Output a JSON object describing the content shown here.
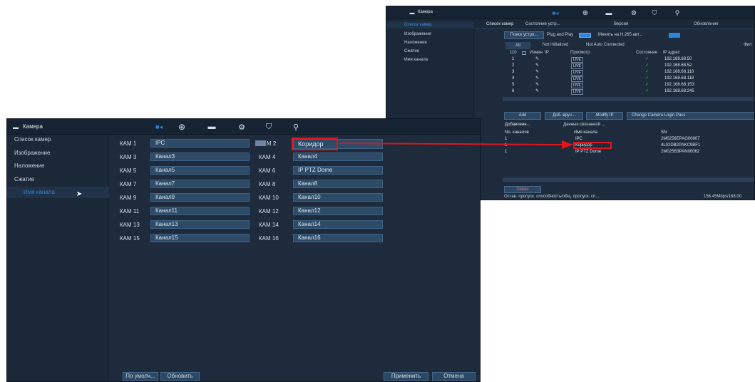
{
  "left": {
    "menu_title": "Камера",
    "sidebar": [
      "Список камер",
      "Изображение",
      "Наложение",
      "Сжатие",
      "Имя канала"
    ],
    "channels": [
      {
        "kam": "КАМ 1",
        "name": "IPC"
      },
      {
        "kam": "M 2",
        "name": "Коридор"
      },
      {
        "kam": "КАМ 3",
        "name": "Канал3"
      },
      {
        "kam": "КАМ 4",
        "name": "Канал4"
      },
      {
        "kam": "КАМ 5",
        "name": "Канал5"
      },
      {
        "kam": "КАМ 6",
        "name": "IP PTZ Dome"
      },
      {
        "kam": "КАМ 7",
        "name": "Канал7"
      },
      {
        "kam": "КАМ 8",
        "name": "Канал8"
      },
      {
        "kam": "КАМ 9",
        "name": "Канал9"
      },
      {
        "kam": "КАМ 10",
        "name": "Канал10"
      },
      {
        "kam": "КАМ 11",
        "name": "Канал11"
      },
      {
        "kam": "КАМ 12",
        "name": "Канал12"
      },
      {
        "kam": "КАМ 13",
        "name": "Канал13"
      },
      {
        "kam": "КАМ 14",
        "name": "Канал14"
      },
      {
        "kam": "КАМ 15",
        "name": "Канал15"
      },
      {
        "kam": "КАМ 16",
        "name": "Канал16"
      }
    ],
    "btn_default": "По умолч...",
    "btn_refresh": "Обновить",
    "btn_apply": "Применить",
    "btn_cancel": "Отмена"
  },
  "right": {
    "menu_title": "Камера",
    "sidebar": [
      "Список камер",
      "Изображение",
      "Наложение",
      "Сжатие",
      "Имя канала"
    ],
    "tabs": [
      "Список камер",
      "Состояние устр...",
      "Версия",
      "Обновление"
    ],
    "btn_search": "Поиск устро...",
    "plug_and_play": "Plug and Play",
    "h265": "Менять на H.265 авт...",
    "filters": [
      "All",
      "Not Initialized",
      "Not Auto Connected",
      "Фил"
    ],
    "cols": [
      "110",
      "Измен. IP",
      "Просмотр",
      "Состояние",
      "IP адрес"
    ],
    "rows": [
      {
        "n": "1",
        "ip": "192.168.68.50"
      },
      {
        "n": "2",
        "ip": "192.168.68.52"
      },
      {
        "n": "3",
        "ip": "192.168.68.110"
      },
      {
        "n": "4",
        "ip": "192.168.68.118"
      },
      {
        "n": "5",
        "ip": "192.168.68.153"
      },
      {
        "n": "6",
        "ip": "192.168.68.245"
      }
    ],
    "live": "LIVE",
    "btns": [
      "Add",
      "Доб. вруч...",
      "Modify IP",
      "Change Camera Login Pass"
    ],
    "added_tabs": [
      "Добавленн...",
      "Данные связанной ..."
    ],
    "added_cols": [
      "No. каналов",
      "Имя канала",
      "SN"
    ],
    "added_rows": [
      {
        "no": "1",
        "name": "IPC",
        "sn": "2M0256EPAG00007"
      },
      {
        "no": "1",
        "name": "Коридор",
        "sn": "4L02DB2PAKC9BF1"
      },
      {
        "no": "1",
        "name": "IP PTZ Dome",
        "sn": "2M025B3PAN00062"
      }
    ],
    "delete": "Delete",
    "footer": "Остав. пропуск. способность/общ. пропуск. сп...",
    "footer_val": "156.45Mbps/168.00"
  },
  "colors": {
    "highlight": "#e0151d",
    "bg": "#1d2b3c",
    "field": "#2d4a67"
  }
}
